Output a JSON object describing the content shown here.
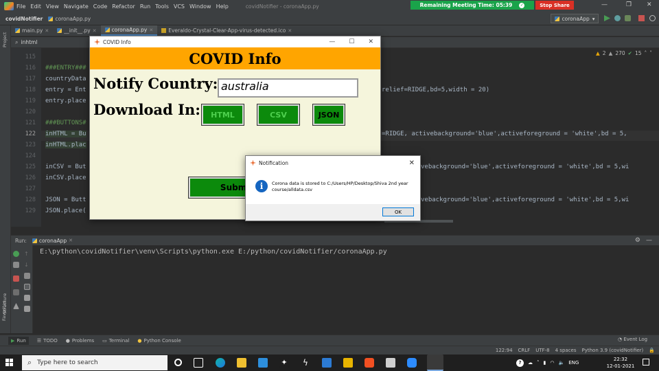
{
  "ide": {
    "menu": [
      "File",
      "Edit",
      "View",
      "Navigate",
      "Code",
      "Refactor",
      "Run",
      "Tools",
      "VCS",
      "Window",
      "Help"
    ],
    "window_title": "covidNotifier - coronaApp.py",
    "project_name": "covidNotifier",
    "current_file": "coronaApp.py",
    "run_config": "coronaApp",
    "search_value": "inhtml",
    "left_strip_label": "Project",
    "tabs": [
      {
        "label": "main.py",
        "active": false
      },
      {
        "label": "__init__.py",
        "active": false
      },
      {
        "label": "coronaApp.py",
        "active": true
      },
      {
        "label": "Everaldo-Crystal-Clear-App-virus-detected.ico",
        "active": false
      }
    ],
    "inspections": {
      "warnings": "2",
      "weak_warnings": "270",
      "typos": "15"
    },
    "gutter": [
      "115",
      "116",
      "117",
      "118",
      "119",
      "120",
      "121",
      "122",
      "123",
      "124",
      "125",
      "126",
      "127",
      "128",
      "129"
    ],
    "code": [
      {
        "a": "    ",
        "b": ""
      },
      {
        "a": "###ENTRY###",
        "b": ""
      },
      {
        "a": "countryData",
        "b": ""
      },
      {
        "a": "entry = Ent",
        "b": "relief=RIDGE,bd=5,width = 20)"
      },
      {
        "a": "entry.place",
        "b": ""
      },
      {
        "a": "",
        "b": ""
      },
      {
        "a": "###BUTTONS#",
        "b": ""
      },
      {
        "a": "inHTML = Bu",
        "b": "=RIDGE, activebackground='blue',activeforeground = 'white',bd = 5,"
      },
      {
        "a": "inHTML.plac",
        "b": ""
      },
      {
        "a": "",
        "b": ""
      },
      {
        "a": "inCSV = But",
        "b": "vebackground='blue',activeforeground = 'white',bd = 5,wi"
      },
      {
        "a": "inCSV.place",
        "b": ""
      },
      {
        "a": "",
        "b": ""
      },
      {
        "a": "JSON = Butt",
        "b": "vebackground='blue',activeforeground = 'white',bd = 5,wi"
      },
      {
        "a": "JSON.place(",
        "b": ""
      }
    ]
  },
  "meeting": {
    "label": "Remaining Meeting Time: 05:39",
    "stop_label": "Stop Share"
  },
  "run_panel": {
    "label": "Run:",
    "tab": "coronaApp",
    "output": "E:\\python\\covidNotifier\\venv\\Scripts\\python.exe E:/python/covidNotifier/coronaApp.py"
  },
  "bottom_tabs": [
    "Run",
    "TODO",
    "Problems",
    "Terminal",
    "Python Console"
  ],
  "event_log": "Event Log",
  "side_labels": {
    "structure": "Structure",
    "favorites": "Favorites"
  },
  "status_bar": [
    "122:94",
    "CRLF",
    "UTF-8",
    "4 spaces",
    "Python 3.9 (covidNotifier)"
  ],
  "covid_window": {
    "title": "COVID Info",
    "banner": "COVID Info",
    "notify_label": "Notify Country:",
    "country_value": "australia",
    "download_label": "Download In:",
    "buttons": [
      "HTML",
      "CSV",
      "JSON"
    ],
    "submit": "Submit"
  },
  "notification": {
    "title": "Notification",
    "message": "Corona data is stored to C:/Users/HP/Desktop/Shiva 2nd year course/alldata.csv",
    "ok": "OK"
  },
  "taskbar": {
    "search_placeholder": "Type here to search",
    "lang": "ENG",
    "time": "22:32",
    "date": "12-01-2021"
  },
  "colors": {
    "ide_bg": "#2b2b2b",
    "banner": "#ffa500",
    "window_bg": "#f5f5dc",
    "button_green": "#0c8a0c",
    "meeting_green": "#1aa34a",
    "stop_red": "#d93025"
  }
}
